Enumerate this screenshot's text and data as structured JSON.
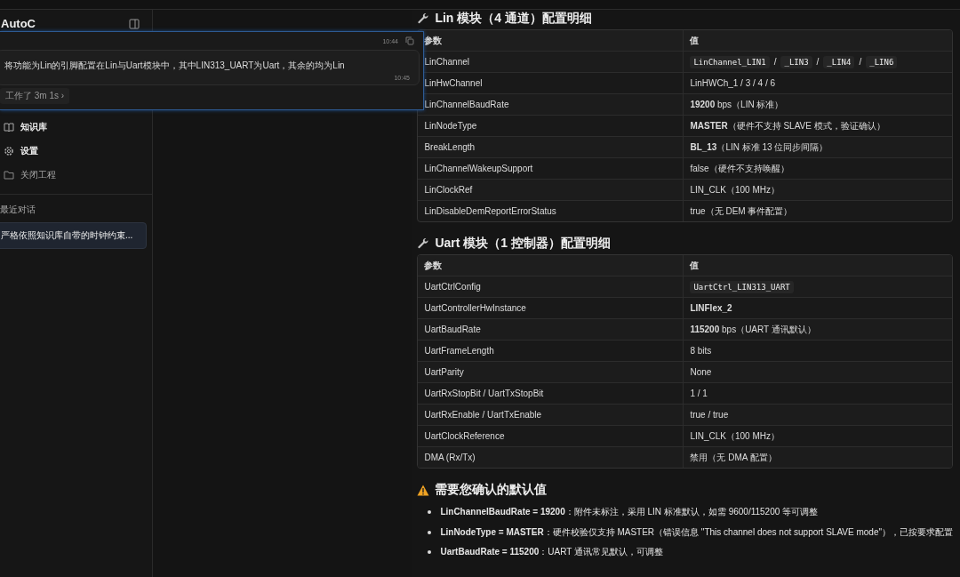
{
  "sidebar": {
    "title": "AutoC",
    "items": [
      {
        "kind": "book",
        "label": "知识库",
        "dim": false
      },
      {
        "kind": "gear",
        "label": "设置",
        "dim": false
      },
      {
        "kind": "folder",
        "label": "关闭工程",
        "dim": true
      }
    ],
    "recent_heading": "最近对话",
    "recent": [
      {
        "label": "严格依照知识库自带的时钟约束...",
        "selected": true
      }
    ]
  },
  "overlay": {
    "time_top": "10:44",
    "message": "将功能为Lin的引脚配置在Lin与Uart模块中，其中LIN313_UART为Uart，其余的均为Lin",
    "time": "10:45",
    "worked": "工作了 3m 1s",
    "chevron": "›"
  },
  "sections": [
    {
      "title": "Lin 模块（4 通道）配置明细",
      "columns": [
        "参数",
        "值"
      ],
      "rows": [
        {
          "param": "LinChannel",
          "kind": "code",
          "codes": [
            "LinChannel_LIN1",
            "_LIN3",
            "_LIN4",
            "_LIN6"
          ],
          "separator": "/"
        },
        {
          "param": "LinHwChannel",
          "kind": "text",
          "value": "LinHWCh_1 / 3 / 4 / 6"
        },
        {
          "param": "LinChannelBaudRate",
          "kind": "text",
          "value": "**19200** bps（LIN 标准）"
        },
        {
          "param": "LinNodeType",
          "kind": "text",
          "value": "**MASTER**（硬件不支持 SLAVE 模式，验证确认）"
        },
        {
          "param": "BreakLength",
          "kind": "text",
          "value": "**BL_13**（LIN 标准 13 位同步间隔）"
        },
        {
          "param": "LinChannelWakeupSupport",
          "kind": "text",
          "value": "false（硬件不支持唤醒）"
        },
        {
          "param": "LinClockRef",
          "kind": "text",
          "value": "LIN_CLK（100 MHz）"
        },
        {
          "param": "LinDisableDemReportErrorStatus",
          "kind": "text",
          "value": "true（无 DEM 事件配置）"
        }
      ]
    },
    {
      "title": "Uart 模块（1 控制器）配置明细",
      "columns": [
        "参数",
        "值"
      ],
      "rows": [
        {
          "param": "UartCtrlConfig",
          "kind": "code",
          "codes": [
            "UartCtrl_LIN313_UART"
          ]
        },
        {
          "param": "UartControllerHwInstance",
          "kind": "bold",
          "value": "LINFlex_2"
        },
        {
          "param": "UartBaudRate",
          "kind": "text",
          "value": "**115200** bps（UART 通讯默认）"
        },
        {
          "param": "UartFrameLength",
          "kind": "text",
          "value": "8 bits"
        },
        {
          "param": "UartParity",
          "kind": "text",
          "value": "None"
        },
        {
          "param": "UartRxStopBit / UartTxStopBit",
          "kind": "text",
          "value": "1 / 1"
        },
        {
          "param": "UartRxEnable / UartTxEnable",
          "kind": "text",
          "value": "true / true"
        },
        {
          "param": "UartClockReference",
          "kind": "text",
          "value": "LIN_CLK（100 MHz）"
        },
        {
          "param": "DMA (Rx/Tx)",
          "kind": "text",
          "value": "禁用（无 DMA 配置）"
        }
      ]
    }
  ],
  "warning": {
    "title": "需要您确认的默认值",
    "items": [
      "**LinChannelBaudRate = 19200**：附件未标注，采用 LIN 标准默认，如需 9600/115200 等可调整",
      "**LinNodeType = MASTER**：硬件校验仅支持 MASTER（错误信息 \"This channel does not support SLAVE mode\"），已按要求配置",
      "**UartBaudRate = 115200**：UART 通讯常见默认，可调整"
    ]
  }
}
